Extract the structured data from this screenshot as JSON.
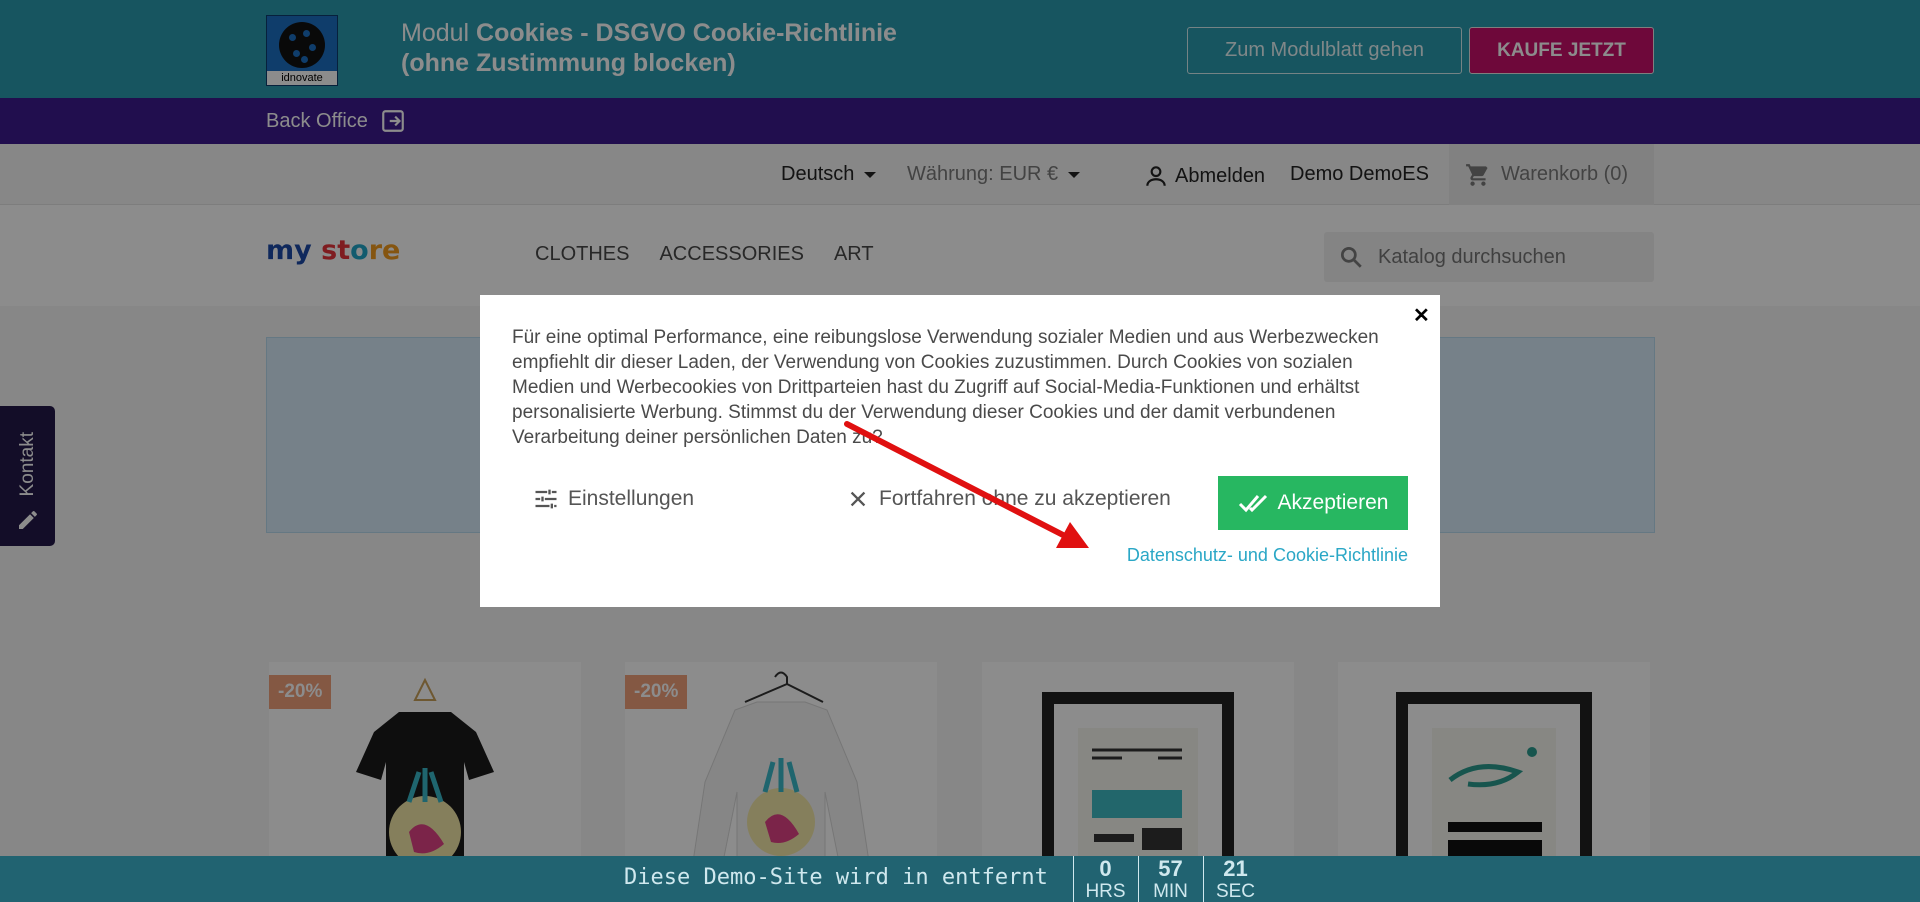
{
  "promo": {
    "logo_brand": "idnovate",
    "title_prefix": "Modul ",
    "title_bold": "Cookies - DSGVO Cookie-Richtlinie",
    "title_line2": "(ohne Zustimmung blocken)",
    "module_sheet_label": "Zum Modulblatt gehen",
    "buy_label": "KAUFE JETZT"
  },
  "backoffice": {
    "label": "Back Office",
    "icon": "login-icon"
  },
  "header_top": {
    "language": "Deutsch",
    "currency": "Währung: EUR €",
    "logout": "Abmelden",
    "user": "Demo DemoES",
    "cart": "Warenkorb (0)"
  },
  "header_main": {
    "logo_parts": [
      "my",
      " ",
      "st",
      "o",
      "re"
    ],
    "menu": [
      "CLOTHES",
      "ACCESSORIES",
      "ART"
    ],
    "search_placeholder": "Katalog durchsuchen"
  },
  "contact_tab": {
    "label": "Kontakt"
  },
  "products": [
    {
      "discount": "-20%"
    },
    {
      "discount": "-20%"
    },
    {
      "discount": ""
    },
    {
      "discount": ""
    }
  ],
  "cookie_modal": {
    "text": "Für eine optimal Performance, eine reibungslose Verwendung sozialer Medien und aus Werbezwecken empfiehlt dir dieser Laden, der Verwendung von Cookies zuzustimmen. Durch Cookies von sozialen Medien und Werbecookies von Drittparteien hast du Zugriff auf Social-Media-Funktionen und erhältst personalisierte Werbung. Stimmst du der Verwendung dieser Cookies und der damit verbundenen Verarbeitung deiner persönlichen Daten zu?",
    "settings_label": "Einstellungen",
    "decline_label": "Fortfahren ohne zu akzeptieren",
    "accept_label": "Akzeptieren",
    "policy_link": "Datenschutz- und Cookie-Richtlinie",
    "close_symbol": "✕"
  },
  "demo_bar": {
    "message": "Diese Demo-Site wird in entfernt",
    "hours": "0",
    "hours_unit": "HRS",
    "minutes": "57",
    "minutes_unit": "MIN",
    "seconds": "21",
    "seconds_unit": "SEC"
  },
  "colors": {
    "promo_bg": "#2a9cb0",
    "backoffice_bg": "#3d1a8f",
    "buy_button": "#c8106b",
    "accept_button": "#27b761",
    "link": "#2aa7c6",
    "annotation_arrow": "#e01010"
  }
}
